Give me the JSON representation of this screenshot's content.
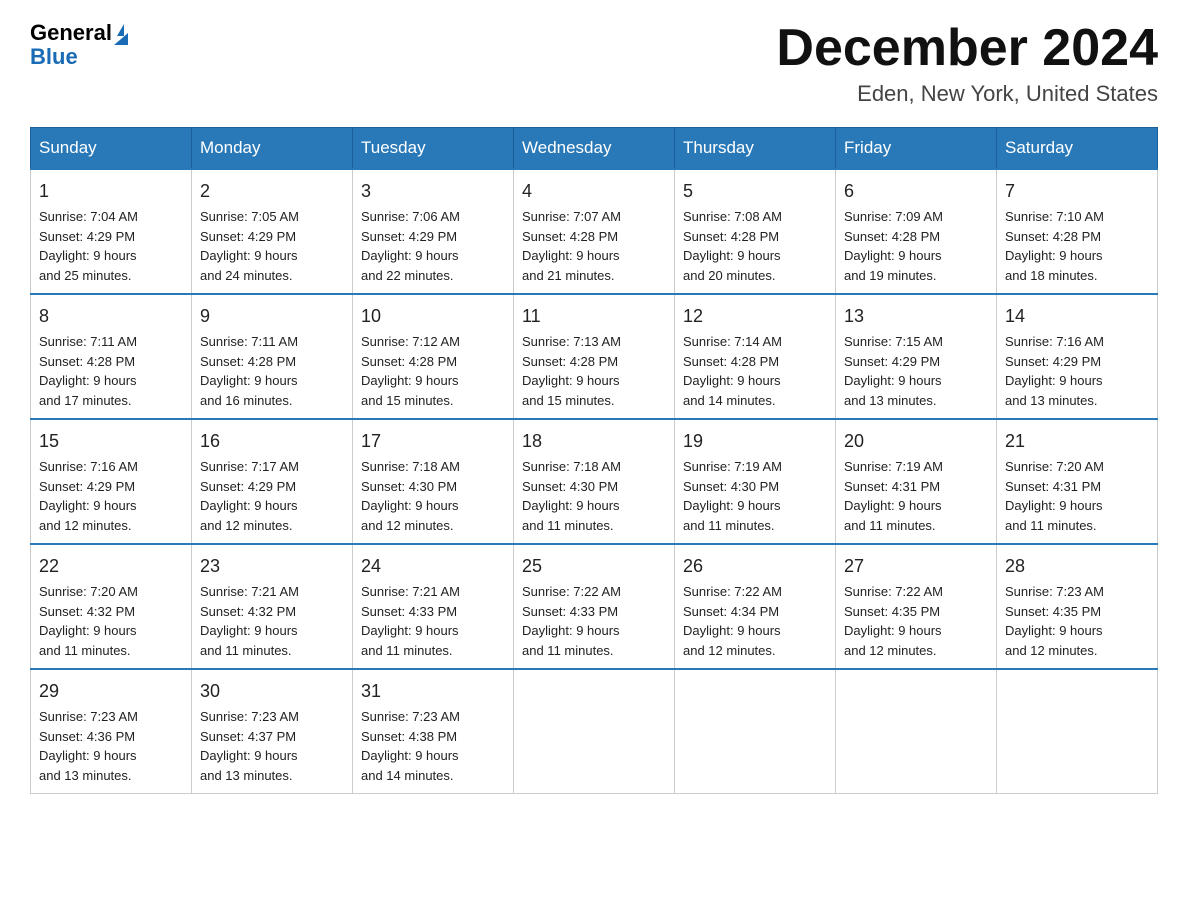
{
  "header": {
    "logo_general": "General",
    "logo_blue": "Blue",
    "month_title": "December 2024",
    "location": "Eden, New York, United States"
  },
  "days_of_week": [
    "Sunday",
    "Monday",
    "Tuesday",
    "Wednesday",
    "Thursday",
    "Friday",
    "Saturday"
  ],
  "weeks": [
    [
      {
        "day": "1",
        "sunrise": "7:04 AM",
        "sunset": "4:29 PM",
        "daylight": "9 hours and 25 minutes."
      },
      {
        "day": "2",
        "sunrise": "7:05 AM",
        "sunset": "4:29 PM",
        "daylight": "9 hours and 24 minutes."
      },
      {
        "day": "3",
        "sunrise": "7:06 AM",
        "sunset": "4:29 PM",
        "daylight": "9 hours and 22 minutes."
      },
      {
        "day": "4",
        "sunrise": "7:07 AM",
        "sunset": "4:28 PM",
        "daylight": "9 hours and 21 minutes."
      },
      {
        "day": "5",
        "sunrise": "7:08 AM",
        "sunset": "4:28 PM",
        "daylight": "9 hours and 20 minutes."
      },
      {
        "day": "6",
        "sunrise": "7:09 AM",
        "sunset": "4:28 PM",
        "daylight": "9 hours and 19 minutes."
      },
      {
        "day": "7",
        "sunrise": "7:10 AM",
        "sunset": "4:28 PM",
        "daylight": "9 hours and 18 minutes."
      }
    ],
    [
      {
        "day": "8",
        "sunrise": "7:11 AM",
        "sunset": "4:28 PM",
        "daylight": "9 hours and 17 minutes."
      },
      {
        "day": "9",
        "sunrise": "7:11 AM",
        "sunset": "4:28 PM",
        "daylight": "9 hours and 16 minutes."
      },
      {
        "day": "10",
        "sunrise": "7:12 AM",
        "sunset": "4:28 PM",
        "daylight": "9 hours and 15 minutes."
      },
      {
        "day": "11",
        "sunrise": "7:13 AM",
        "sunset": "4:28 PM",
        "daylight": "9 hours and 15 minutes."
      },
      {
        "day": "12",
        "sunrise": "7:14 AM",
        "sunset": "4:28 PM",
        "daylight": "9 hours and 14 minutes."
      },
      {
        "day": "13",
        "sunrise": "7:15 AM",
        "sunset": "4:29 PM",
        "daylight": "9 hours and 13 minutes."
      },
      {
        "day": "14",
        "sunrise": "7:16 AM",
        "sunset": "4:29 PM",
        "daylight": "9 hours and 13 minutes."
      }
    ],
    [
      {
        "day": "15",
        "sunrise": "7:16 AM",
        "sunset": "4:29 PM",
        "daylight": "9 hours and 12 minutes."
      },
      {
        "day": "16",
        "sunrise": "7:17 AM",
        "sunset": "4:29 PM",
        "daylight": "9 hours and 12 minutes."
      },
      {
        "day": "17",
        "sunrise": "7:18 AM",
        "sunset": "4:30 PM",
        "daylight": "9 hours and 12 minutes."
      },
      {
        "day": "18",
        "sunrise": "7:18 AM",
        "sunset": "4:30 PM",
        "daylight": "9 hours and 11 minutes."
      },
      {
        "day": "19",
        "sunrise": "7:19 AM",
        "sunset": "4:30 PM",
        "daylight": "9 hours and 11 minutes."
      },
      {
        "day": "20",
        "sunrise": "7:19 AM",
        "sunset": "4:31 PM",
        "daylight": "9 hours and 11 minutes."
      },
      {
        "day": "21",
        "sunrise": "7:20 AM",
        "sunset": "4:31 PM",
        "daylight": "9 hours and 11 minutes."
      }
    ],
    [
      {
        "day": "22",
        "sunrise": "7:20 AM",
        "sunset": "4:32 PM",
        "daylight": "9 hours and 11 minutes."
      },
      {
        "day": "23",
        "sunrise": "7:21 AM",
        "sunset": "4:32 PM",
        "daylight": "9 hours and 11 minutes."
      },
      {
        "day": "24",
        "sunrise": "7:21 AM",
        "sunset": "4:33 PM",
        "daylight": "9 hours and 11 minutes."
      },
      {
        "day": "25",
        "sunrise": "7:22 AM",
        "sunset": "4:33 PM",
        "daylight": "9 hours and 11 minutes."
      },
      {
        "day": "26",
        "sunrise": "7:22 AM",
        "sunset": "4:34 PM",
        "daylight": "9 hours and 12 minutes."
      },
      {
        "day": "27",
        "sunrise": "7:22 AM",
        "sunset": "4:35 PM",
        "daylight": "9 hours and 12 minutes."
      },
      {
        "day": "28",
        "sunrise": "7:23 AM",
        "sunset": "4:35 PM",
        "daylight": "9 hours and 12 minutes."
      }
    ],
    [
      {
        "day": "29",
        "sunrise": "7:23 AM",
        "sunset": "4:36 PM",
        "daylight": "9 hours and 13 minutes."
      },
      {
        "day": "30",
        "sunrise": "7:23 AM",
        "sunset": "4:37 PM",
        "daylight": "9 hours and 13 minutes."
      },
      {
        "day": "31",
        "sunrise": "7:23 AM",
        "sunset": "4:38 PM",
        "daylight": "9 hours and 14 minutes."
      },
      null,
      null,
      null,
      null
    ]
  ],
  "labels": {
    "sunrise": "Sunrise:",
    "sunset": "Sunset:",
    "daylight": "Daylight:"
  }
}
